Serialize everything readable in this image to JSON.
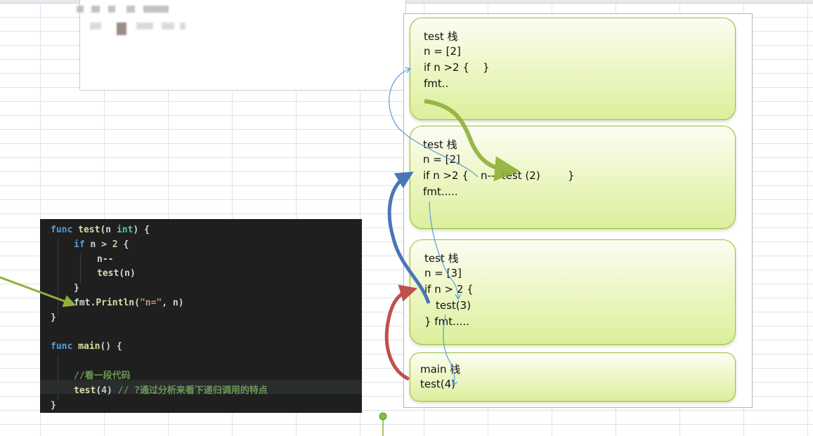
{
  "code_panel": {
    "lines": [
      {
        "a": "func ",
        "b": "test",
        "c": "(n ",
        "d": "int",
        "e": ") {"
      },
      {
        "a": "if ",
        "b": "n > ",
        "c": "2",
        "d": " {"
      },
      {
        "a": "n--"
      },
      {
        "a": "test",
        "b": "(n)"
      },
      {
        "a": "}"
      },
      {
        "a": "fmt.",
        "b": "Println",
        "c": "(",
        "d": "\"n=\"",
        "e": ", n)"
      },
      {
        "a": "}"
      },
      {
        "a": ""
      },
      {
        "a": "func ",
        "b": "main",
        "c": "() {"
      },
      {
        "a": ""
      },
      {
        "a": "//看一段代码"
      },
      {
        "a": "test",
        "b": "(",
        "c": "4",
        "d": ") ",
        "e": "// ?通过分析来看下递归调用的特点"
      },
      {
        "a": "}"
      }
    ]
  },
  "stack_diagram": {
    "frames": [
      {
        "title": "test 栈",
        "line1": "n = [2]",
        "line2": "if n >2 {    }",
        "line3": "fmt.."
      },
      {
        "title": "test 栈",
        "line1": "n = [2]",
        "line2": "if n >2 {",
        "line2b": "n--  test (2)",
        "line2c": "}",
        "line3": "fmt....."
      },
      {
        "title": "test 栈",
        "line1": "n = [3]",
        "line2": "if n > 2 {",
        "line3": "test(3)",
        "line4": "} fmt....."
      },
      {
        "title": "main 栈",
        "line1": "test(4)"
      }
    ]
  },
  "colors": {
    "arrow_green": "#8fb03a",
    "arrow_blue": "#4a76b8",
    "arrow_red": "#c0504d",
    "thin_blue": "#5b9bd5"
  }
}
